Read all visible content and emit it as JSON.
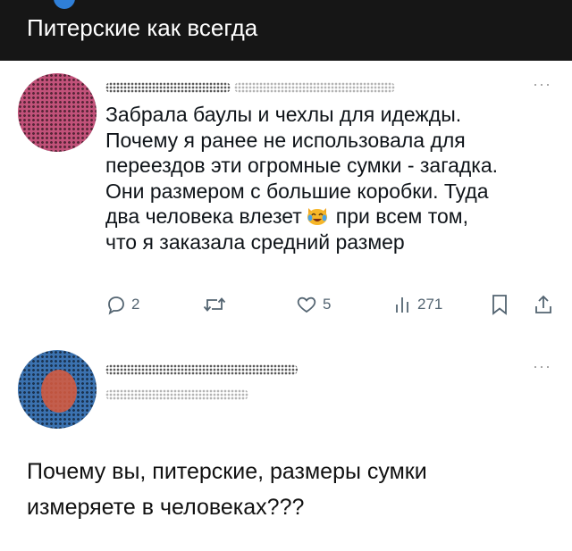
{
  "header": {
    "title": "Питерские как всегда"
  },
  "tweet": {
    "text_lines": [
      "Забрала баулы и чехлы для идежды.",
      "Почему я ранее не использовала для",
      "переездов эти огромные сумки - загадка.",
      "Они размером с большие коробки. Туда",
      "два человека влезет",
      "при всем том,",
      "что я заказала средний размер"
    ],
    "emoji": "laughing-cat-emoji",
    "more_icon": "ellipsis-icon",
    "actions": {
      "replies": "2",
      "likes": "5",
      "views": "271"
    }
  },
  "reply": {
    "more_icon": "ellipsis-icon"
  },
  "comment": {
    "lines": [
      "Почему вы, питерские, размеры сумки",
      "измеряете в человеках???"
    ]
  },
  "colors": {
    "topbar": "#161616",
    "text": "#0f1419",
    "icons": "#536471"
  }
}
